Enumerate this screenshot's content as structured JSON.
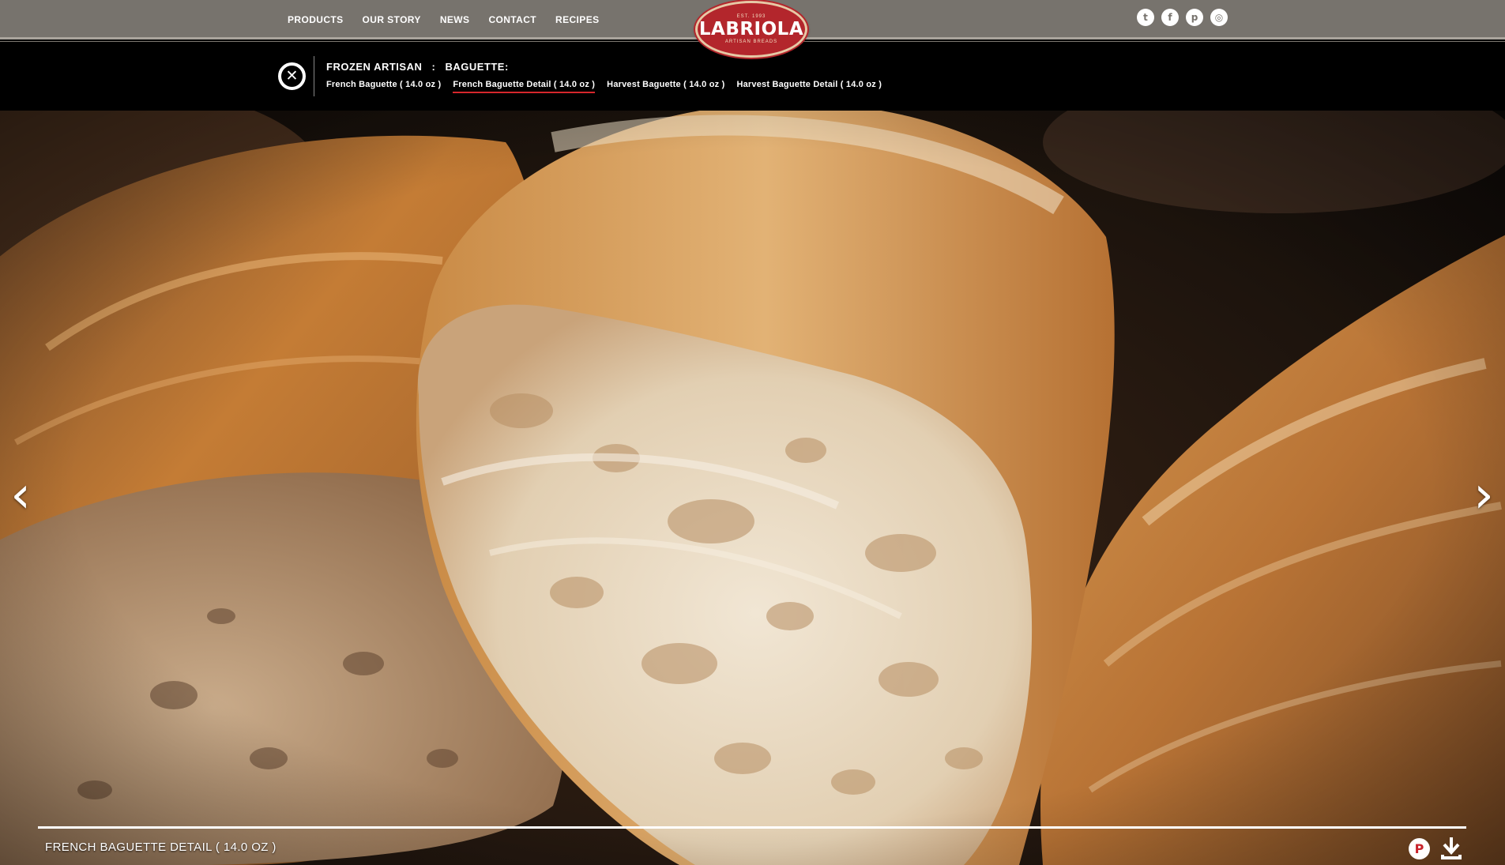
{
  "nav": {
    "items": [
      "PRODUCTS",
      "OUR STORY",
      "NEWS",
      "CONTACT",
      "RECIPES"
    ]
  },
  "logo": {
    "est": "EST. 1993",
    "name": "LABRIOLA",
    "tagline": "ARTISAN BREADS"
  },
  "social": {
    "icons": [
      "twitter-icon",
      "facebook-icon",
      "pinterest-icon",
      "instagram-icon"
    ],
    "glyphs": [
      "t",
      "f",
      "p",
      "◎"
    ]
  },
  "breadcrumb": {
    "category": "FROZEN ARTISAN",
    "separator": ":",
    "subcategory": "BAGUETTE:"
  },
  "products": [
    {
      "label": "French Baguette ( 14.0 oz )",
      "active": false
    },
    {
      "label": "French Baguette Detail ( 14.0 oz )",
      "active": true
    },
    {
      "label": "Harvest Baguette ( 14.0 oz )",
      "active": false
    },
    {
      "label": "Harvest Baguette Detail ( 14.0 oz )",
      "active": false
    }
  ],
  "slider": {
    "prev_glyph": "‹",
    "next_glyph": "›"
  },
  "caption": {
    "title": "FRENCH BAGUETTE DETAIL ( 14.0 OZ )"
  },
  "colors": {
    "nav_bg": "#77736d",
    "logo_red": "#b3262c",
    "active_underline": "#d6262c",
    "strip_bg": "#000000"
  }
}
